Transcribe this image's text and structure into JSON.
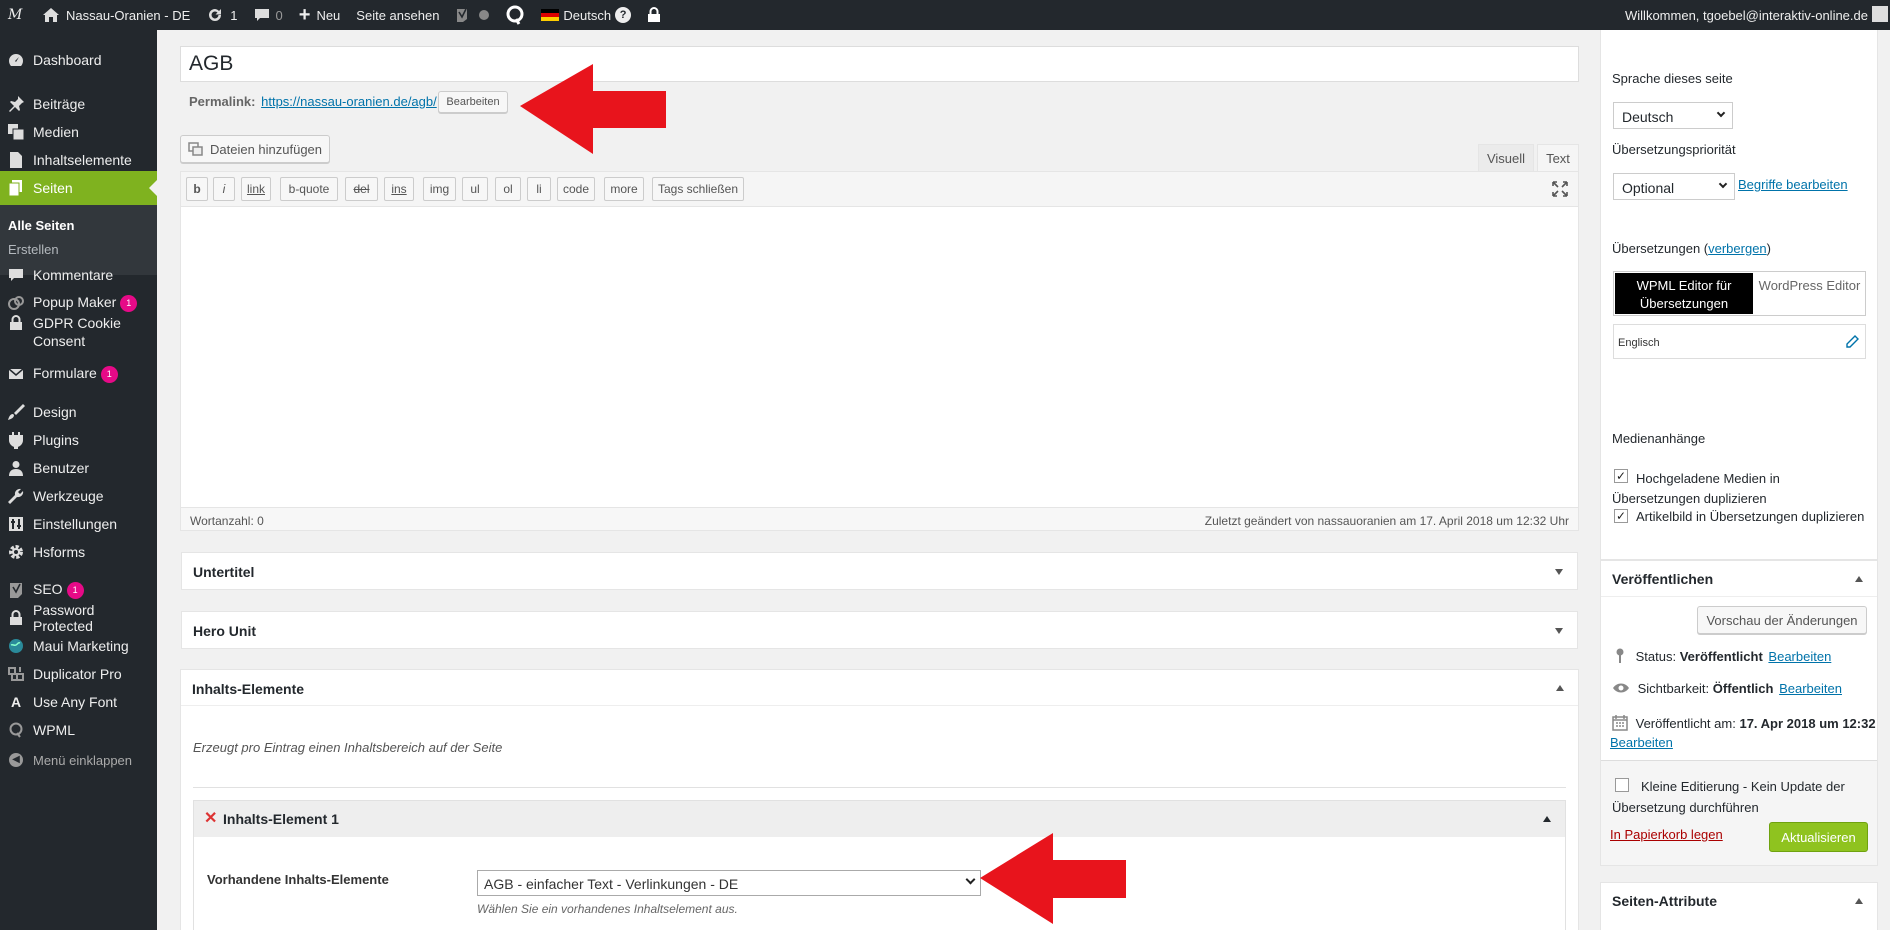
{
  "admin_bar": {
    "site_name": "Nassau-Oranien - DE",
    "updates_count": "1",
    "comments_count": "0",
    "new_label": "Neu",
    "view_page_label": "Seite ansehen",
    "language_label": "Deutsch",
    "greeting": "Willkommen, tgoebel@interaktiv-online.de"
  },
  "sidebar": {
    "items": [
      {
        "label": "Dashboard",
        "icon": "dashboard-icon"
      },
      {
        "label": "Beiträge",
        "icon": "pin-icon"
      },
      {
        "label": "Medien",
        "icon": "media-icon"
      },
      {
        "label": "Inhaltselemente",
        "icon": "page-icon"
      },
      {
        "label": "Seiten",
        "icon": "pages-icon"
      },
      {
        "label": "Kommentare",
        "icon": "comment-icon"
      },
      {
        "label": "Popup Maker",
        "icon": "popup-icon",
        "badge": "1"
      },
      {
        "label": "GDPR Cookie Consent",
        "icon": "lock-icon"
      },
      {
        "label": "Formulare",
        "icon": "mail-icon",
        "badge": "1"
      },
      {
        "label": "Design",
        "icon": "brush-icon"
      },
      {
        "label": "Plugins",
        "icon": "plug-icon"
      },
      {
        "label": "Benutzer",
        "icon": "user-icon"
      },
      {
        "label": "Werkzeuge",
        "icon": "wrench-icon"
      },
      {
        "label": "Einstellungen",
        "icon": "settings-icon"
      },
      {
        "label": "Hsforms",
        "icon": "gear-icon"
      },
      {
        "label": "SEO",
        "icon": "seo-icon",
        "badge": "1"
      },
      {
        "label": "Password Protected",
        "icon": "lock-icon"
      },
      {
        "label": "Maui Marketing",
        "icon": "globe-icon"
      },
      {
        "label": "Duplicator Pro",
        "icon": "duplicator-icon"
      },
      {
        "label": "Use Any Font",
        "icon": "font-icon"
      },
      {
        "label": "WPML",
        "icon": "wpml-icon"
      }
    ],
    "submenu": [
      "Alle Seiten",
      "Erstellen"
    ],
    "collapse_label": "Menü einklappen"
  },
  "editor": {
    "title": "AGB",
    "permalink_label": "Permalink:",
    "permalink_url": "https://nassau-oranien.de/agb/",
    "permalink_edit": "Bearbeiten",
    "add_media": "Dateien hinzufügen",
    "tab_visual": "Visuell",
    "tab_text": "Text",
    "quicktags": [
      "b",
      "i",
      "link",
      "b-quote",
      "del",
      "ins",
      "img",
      "ul",
      "ol",
      "li",
      "code",
      "more",
      "Tags schließen"
    ],
    "word_count": "Wortanzahl: 0",
    "last_edited": "Zuletzt geändert von nassauoranien am 17. April 2018 um 12:32 Uhr"
  },
  "panels": {
    "untertitel": "Untertitel",
    "hero_unit": "Hero Unit",
    "inhalts_elemente": "Inhalts-Elemente",
    "description": "Erzeugt pro Eintrag einen Inhaltsbereich auf der Seite",
    "element_title": "Inhalts-Element 1",
    "existing_label": "Vorhandene Inhalts-Elemente",
    "existing_value": "AGB - einfacher Text - Verlinkungen - DE",
    "existing_hint": "Wählen Sie ein vorhandenes Inhaltselement aus."
  },
  "wpml": {
    "language_label": "Sprache dieses seite",
    "language_value": "Deutsch",
    "priority_label": "Übersetzungspriorität",
    "priority_value": "Optional",
    "terms_link": "Begriffe bearbeiten",
    "translations_label": "Übersetzungen (",
    "translations_hide": "verbergen",
    "translations_close": ")",
    "wpml_editor": "WPML Editor für Übersetzungen",
    "wp_editor": "WordPress Editor",
    "english": "Englisch",
    "media_label": "Medienanhänge",
    "media_dup": "Hochgeladene Medien in Übersetzungen duplizieren",
    "featured_dup": "Artikelbild in Übersetzungen duplizieren"
  },
  "publish": {
    "title": "Veröffentlichen",
    "preview": "Vorschau der Änderungen",
    "status_label": "Status:",
    "status_value": "Veröffentlicht",
    "visibility_label": "Sichtbarkeit:",
    "visibility_value": "Öffentlich",
    "published_label": "Veröffentlicht am:",
    "published_value": "17. Apr 2018 um 12:32",
    "edit": "Bearbeiten",
    "minor_edit": "Kleine Editierung - Kein Update der Übersetzung durchführen",
    "trash": "In Papierkorb legen",
    "update": "Aktualisieren"
  },
  "page_attributes": {
    "title": "Seiten-Attribute"
  },
  "colors": {
    "accent": "#7fb21f",
    "adminbar": "#23282d",
    "arrow": "#e8141c",
    "link": "#0073aa",
    "update_btn": "#8fc31f"
  }
}
